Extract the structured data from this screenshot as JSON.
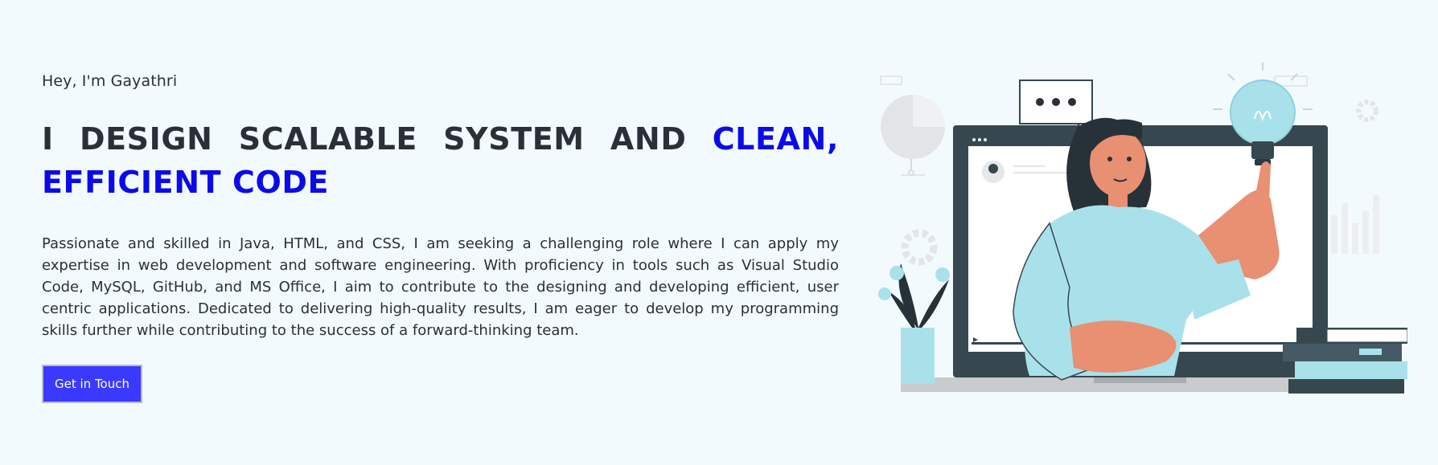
{
  "hero": {
    "greeting": "Hey, I'm Gayathri",
    "headline_main": "I DESIGN SCALABLE SYSTEM AND ",
    "headline_accent": "CLEAN, EFFICIENT CODE",
    "bio": "Passionate and skilled in Java, HTML, and CSS, I am seeking a challenging role where I can apply my expertise in web development and software engineering. With proficiency in tools such as Visual Studio Code, MySQL, GitHub, and MS Office, I aim to contribute to the designing and developing efficient, user centric applications. Dedicated to delivering high-quality results, I am eager to develop my programming skills further while contributing to the success of a forward-thinking team.",
    "cta_label": "Get in Touch"
  },
  "colors": {
    "background": "#f3fafd",
    "accent_text": "#0b0bea",
    "button": "#3a3aff",
    "skin": "#e98f72",
    "shirt": "#a9e1ea",
    "laptop": "#37474f"
  },
  "illustration": {
    "icon": "woman-with-lightbulb-laptop-illustration"
  }
}
